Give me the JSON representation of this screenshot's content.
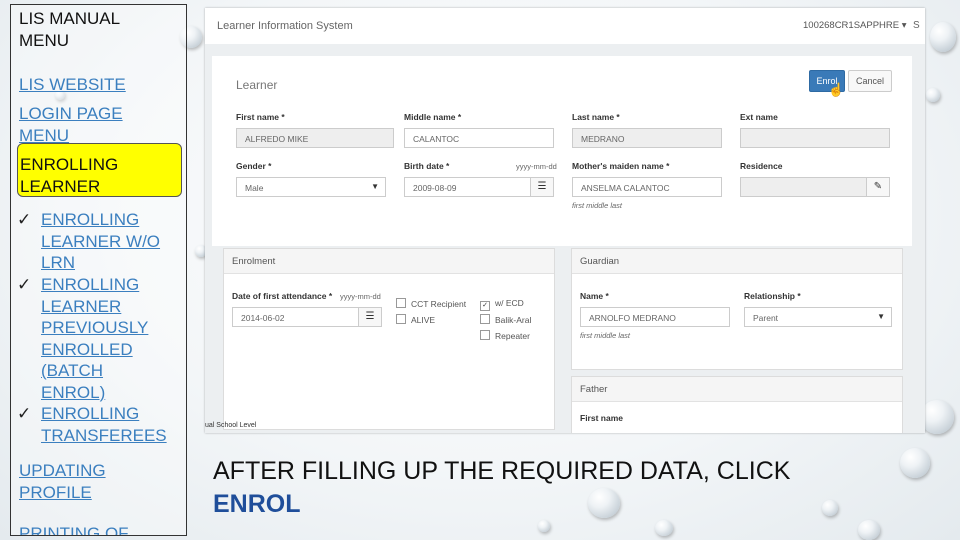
{
  "menu": {
    "title": "LIS MANUAL MENU",
    "lis_website": "LIS WEBSITE",
    "login_page": "LOGIN PAGE MENU",
    "active": "ENROLLING LEARNER",
    "check_glyph": "ü",
    "sub_items": [
      "ENROLLING LEARNER W/O LRN",
      "ENROLLING LEARNER PREVIOUSLY ENROLLED (BATCH ENROL)",
      "ENROLLING TRANSFEREES"
    ],
    "updating_profile": "UPDATING PROFILE",
    "printing_of": "PRINTING OF"
  },
  "app": {
    "title": "Learner Information System",
    "user": "100268CR1SAPPHRE ▾",
    "right_letter": "S",
    "learner": {
      "heading": "Learner",
      "enrol_button": "Enrol",
      "cancel_button": "Cancel",
      "first_name_label": "First name *",
      "first_name_value": "ALFREDO MIKE",
      "middle_name_label": "Middle name *",
      "middle_name_value": "CALANTOC",
      "last_name_label": "Last name *",
      "last_name_value": "MEDRANO",
      "ext_name_label": "Ext name",
      "gender_label": "Gender *",
      "gender_value": "Male",
      "birth_date_label": "Birth date *",
      "birth_date_hint": "yyyy-mm-dd",
      "birth_date_value": "2009-08-09",
      "mother_label": "Mother's maiden name *",
      "mother_value": "ANSELMA CALANTOC",
      "mother_hint": "first middle last",
      "residence_label": "Residence"
    },
    "enrolment": {
      "heading": "Enrolment",
      "date_label": "Date of first attendance *",
      "date_hint": "yyyy-mm-dd",
      "date_value": "2014-06-02",
      "checkboxes": [
        {
          "label": "CCT Recipient",
          "checked": false
        },
        {
          "label": "ALIVE",
          "checked": false
        },
        {
          "label": "w/ ECD",
          "checked": true
        },
        {
          "label": "Balik-Aral",
          "checked": false
        },
        {
          "label": "Repeater",
          "checked": false
        }
      ]
    },
    "guardian": {
      "heading": "Guardian",
      "name_label": "Name *",
      "name_value": "ARNOLFO MEDRANO",
      "name_hint": "first middle last",
      "relationship_label": "Relationship *",
      "relationship_value": "Parent"
    },
    "father": {
      "heading": "Father",
      "first_name_label": "First name"
    },
    "bottom_tab": "ual School Level"
  },
  "caption": {
    "text": "AFTER FILLING UP THE REQUIRED DATA, CLICK",
    "keyword": "ENROL"
  }
}
